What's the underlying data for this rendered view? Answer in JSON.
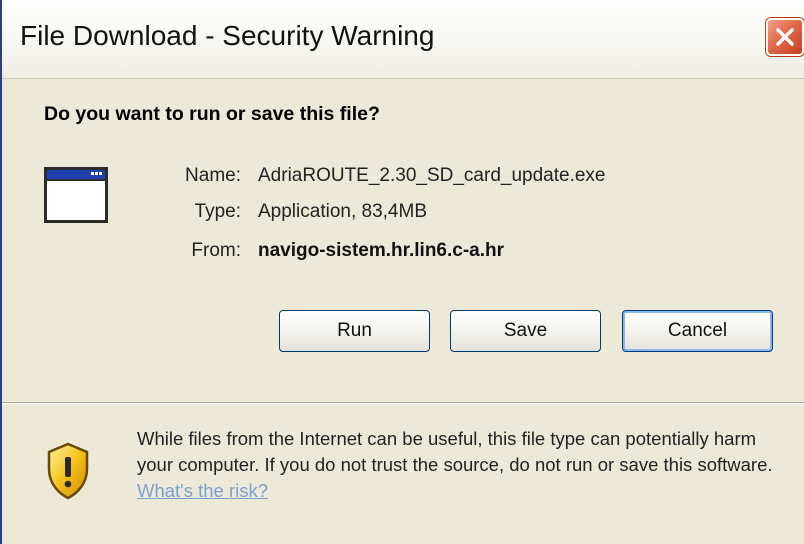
{
  "window": {
    "title": "File Download - Security Warning",
    "close_icon": "close-icon",
    "accent_close_color": "#d9532e"
  },
  "content": {
    "question": "Do you want to run or save this file?",
    "file_icon": "application-window-icon",
    "name_label": "Name:",
    "name_value": "AdriaROUTE_2.30_SD_card_update.exe",
    "type_label": "Type:",
    "type_value": "Application, 83,4MB",
    "from_label": "From:",
    "from_value": "navigo-sistem.hr.lin6.c-a.hr"
  },
  "buttons": {
    "run": "Run",
    "save": "Save",
    "cancel": "Cancel"
  },
  "warning": {
    "shield_icon": "security-shield-icon",
    "text": "While files from the Internet can be useful, this file type can potentially harm your computer. If you do not trust the source, do not run or save this software. ",
    "risk_link": "What's the risk?"
  }
}
